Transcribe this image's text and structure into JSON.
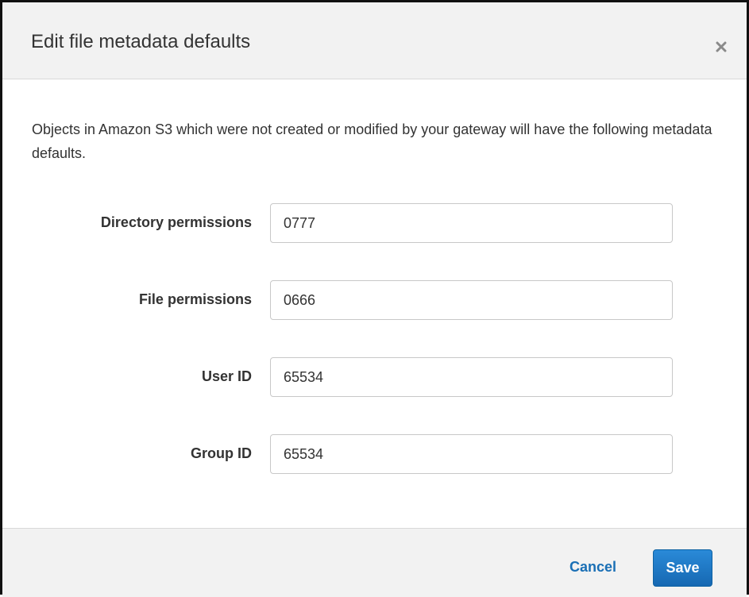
{
  "dialog": {
    "title": "Edit file metadata defaults",
    "close_icon": "close-icon",
    "description": "Objects in Amazon S3 which were not created or modified by your gateway will have the following metadata defaults."
  },
  "form": {
    "fields": [
      {
        "label": "Directory permissions",
        "value": "0777"
      },
      {
        "label": "File permissions",
        "value": "0666"
      },
      {
        "label": "User ID",
        "value": "65534"
      },
      {
        "label": "Group ID",
        "value": "65534"
      }
    ]
  },
  "footer": {
    "cancel_label": "Cancel",
    "save_label": "Save"
  },
  "colors": {
    "header_bg": "#f2f2f2",
    "link_blue": "#1a6fb5",
    "primary_blue": "#1f7bc8"
  }
}
